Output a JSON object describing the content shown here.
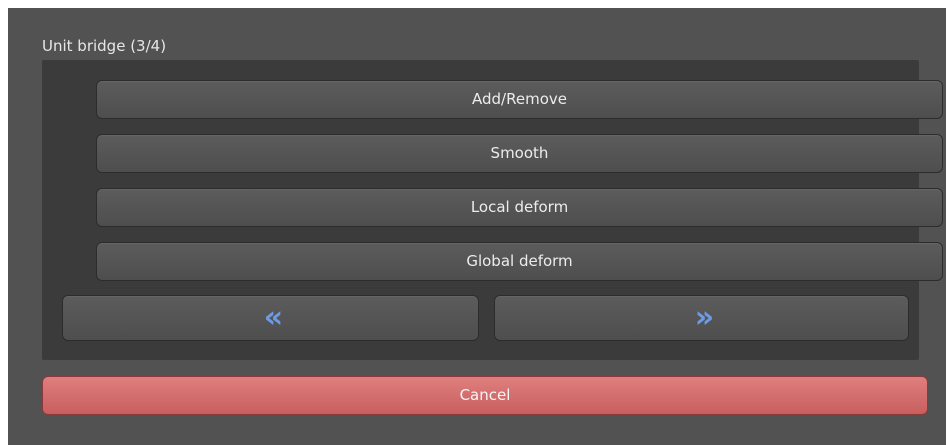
{
  "group": {
    "title": "Unit bridge (3/4)"
  },
  "buttons": {
    "add_remove": "Add/Remove",
    "smooth": "Smooth",
    "local_deform": "Local deform",
    "global_deform": "Global deform",
    "previous_glyph": "«",
    "next_glyph": "»",
    "cancel": "Cancel"
  },
  "icons": {
    "previous": "double-chevron-left-icon",
    "next": "double-chevron-right-icon"
  },
  "colors": {
    "panel_bg": "#525252",
    "group_bg": "#3b3b3b",
    "chevron": "#6d9be6",
    "cancel_bg": "#d96c6c"
  }
}
